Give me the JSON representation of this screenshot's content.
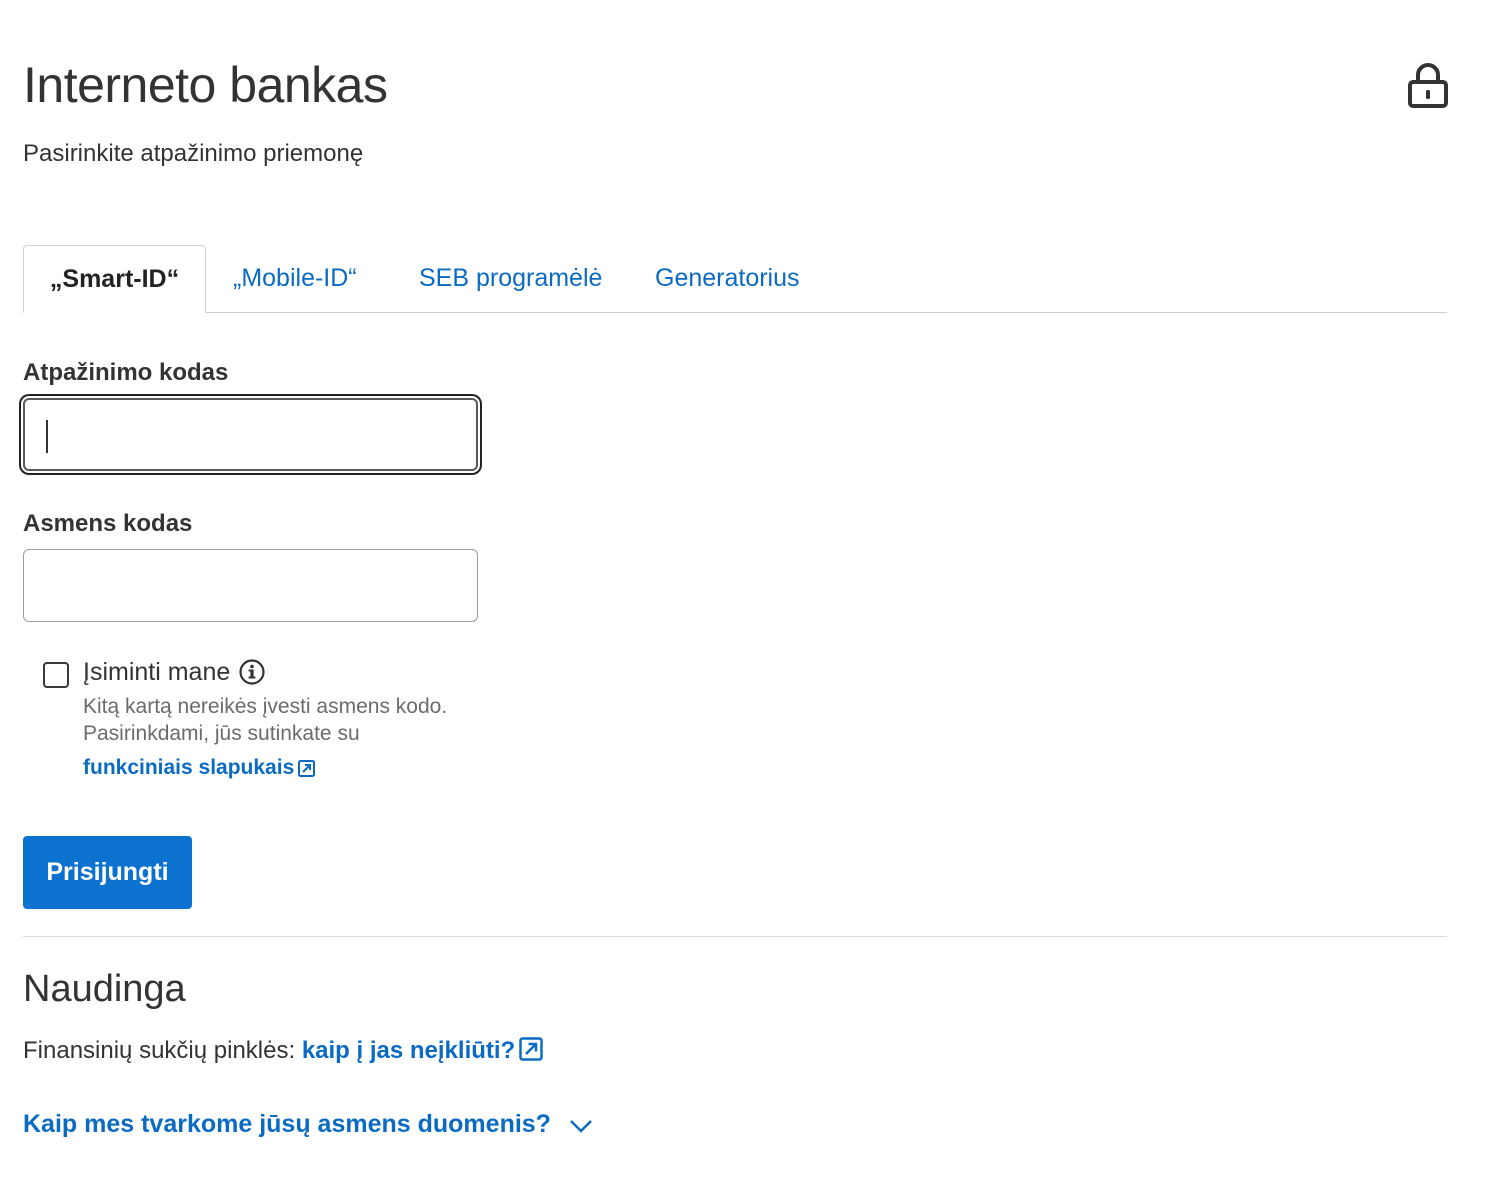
{
  "header": {
    "title": "Interneto bankas",
    "lock_icon": "lock-icon",
    "subtitle": "Pasirinkite atpažinimo priemonę"
  },
  "tabs": [
    {
      "label": "„Smart-ID“",
      "active": true
    },
    {
      "label": "„Mobile-ID“",
      "active": false
    },
    {
      "label": "SEB programėlė",
      "active": false
    },
    {
      "label": "Generatorius",
      "active": false
    }
  ],
  "form": {
    "identification_code": {
      "label": "Atpažinimo kodas",
      "value": ""
    },
    "personal_code": {
      "label": "Asmens kodas",
      "value": ""
    },
    "remember": {
      "label": "Įsiminti mane",
      "checked": false,
      "hint_line1": "Kitą kartą nereikės įvesti asmens kodo.",
      "hint_line2": "Pasirinkdami, jūs sutinkate su",
      "link": "funkciniais slapukais"
    },
    "submit_label": "Prisijungti"
  },
  "useful": {
    "title": "Naudinga",
    "fraud_text": "Finansinių sukčių pinklės:",
    "fraud_link": "kaip į jas neįkliūti?",
    "accordion_label": "Kaip mes tvarkome jūsų asmens duomenis?"
  },
  "colors": {
    "link": "#0b6bc2",
    "button": "#0b72d0",
    "text": "#333333"
  }
}
